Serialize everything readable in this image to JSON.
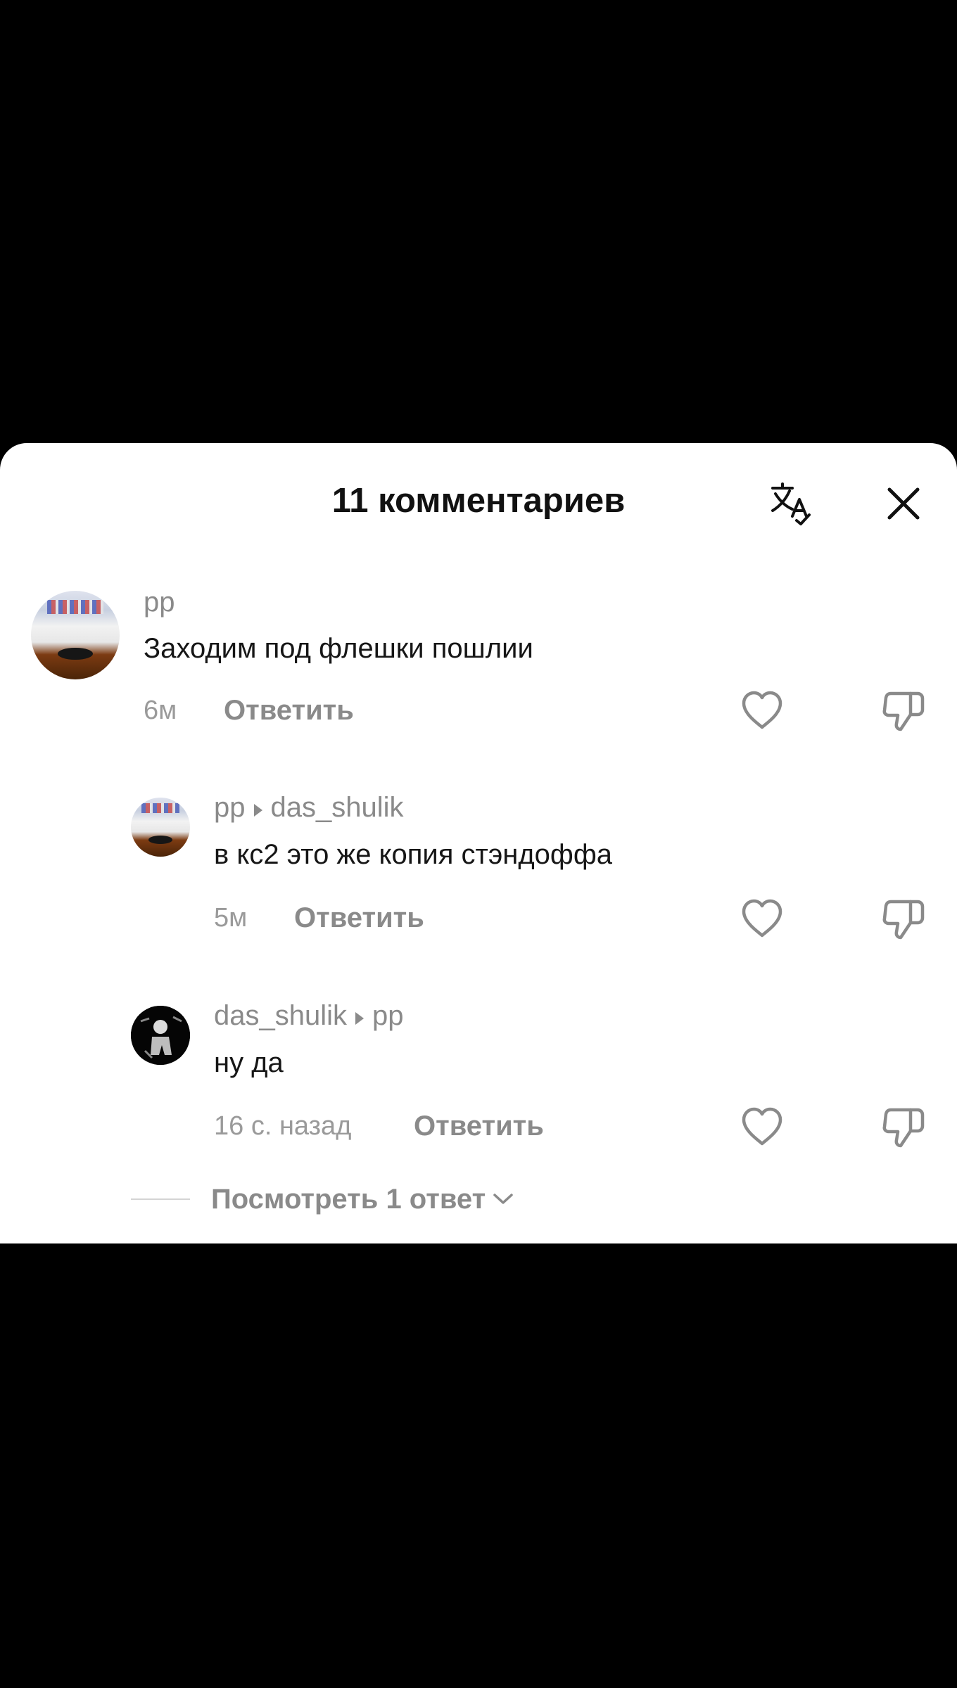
{
  "header": {
    "title": "11 комментариев"
  },
  "comments": [
    {
      "author": "pp",
      "reply_to": "",
      "text": "Заходим под флешки пошлии",
      "time": "6м",
      "reply_label": "Ответить"
    },
    {
      "author": "pp",
      "reply_to": "das_shulik",
      "text": "в кс2 это же копия стэндоффа",
      "time": "5м",
      "reply_label": "Ответить"
    },
    {
      "author": "das_shulik",
      "reply_to": "pp",
      "text": "ну да",
      "time": "16 с. назад",
      "reply_label": "Ответить"
    }
  ],
  "view_replies_label": "Посмотреть 1 ответ",
  "colors": {
    "sheet_background": "#ffffff",
    "outer_background": "#000000",
    "muted_text": "#8a8a8a",
    "primary_text": "#161616"
  },
  "icons": {
    "translate": "translate-icon",
    "close": "close-icon",
    "like": "heart-outline-icon",
    "dislike": "thumbs-down-outline-icon",
    "reply_arrow": "triangle-right-icon",
    "chevron": "chevron-down-icon"
  }
}
